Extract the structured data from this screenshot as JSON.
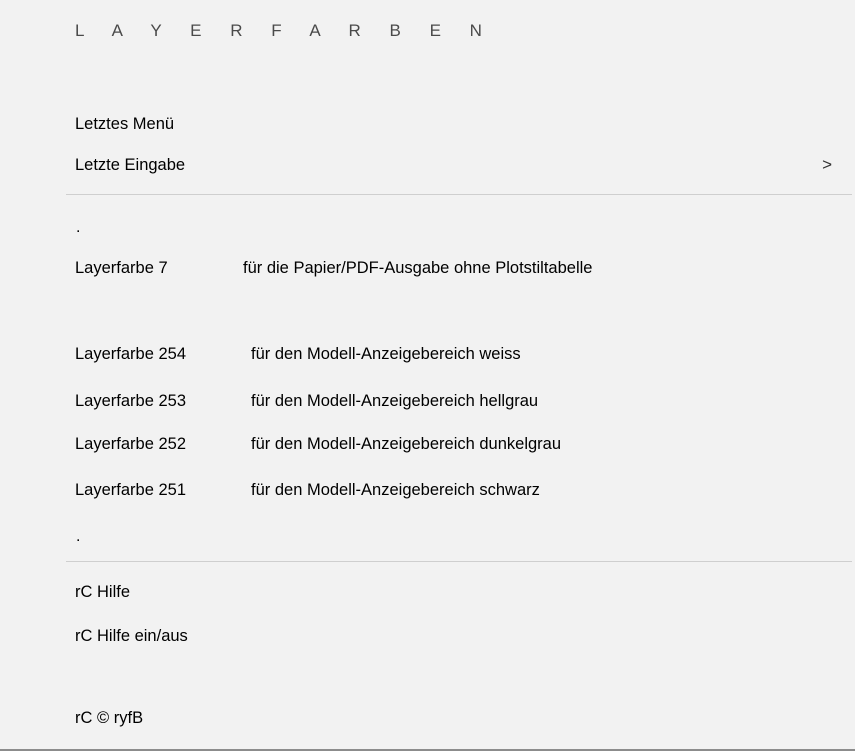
{
  "menu": {
    "title": "L A Y E R F A R B E N",
    "last_menu": "Letztes Menü",
    "last_input": "Letzte Eingabe",
    "submenu_arrow": ">",
    "dot1": ".",
    "items": [
      {
        "code": "Layerfarbe 7",
        "desc": "für die Papier/PDF-Ausgabe ohne Plotstiltabelle"
      },
      {
        "code": "Layerfarbe 254",
        "desc": "für den Modell-Anzeigebereich weiss"
      },
      {
        "code": "Layerfarbe 253",
        "desc": "für den Modell-Anzeigebereich hellgrau"
      },
      {
        "code": "Layerfarbe 252",
        "desc": "für den Modell-Anzeigebereich dunkelgrau"
      },
      {
        "code": "Layerfarbe 251",
        "desc": "für den Modell-Anzeigebereich schwarz"
      }
    ],
    "dot2": ".",
    "help": "rC Hilfe",
    "help_toggle": "rC Hilfe ein/aus",
    "copyright": "rC © ryfB"
  }
}
